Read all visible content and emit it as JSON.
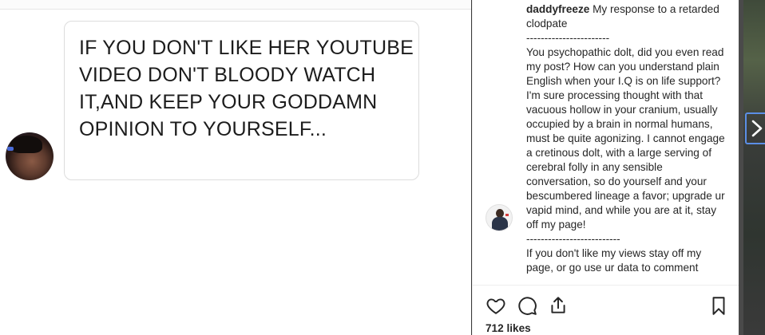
{
  "post_image": {
    "bubble_text": "IF YOU DON'T LIKE HER YOUTUBE VIDEO DON'T BLOODY WATCH IT,AND KEEP YOUR GODDAMN OPINION TO YOURSELF..."
  },
  "comment": {
    "username": "daddyfreeze",
    "body": " My response to a retarded clodpate\n-----------------------\nYou psychopathic dolt, did you even read my post? How can you understand plain English when your I.Q is on life support? I'm sure processing thought with that vacuous hollow in your cranium, usually occupied by a brain in normal humans, must be quite agonizing. I cannot engage a cretinous dolt, with a large serving of cerebral folly in any sensible conversation, so do yourself and your bescumbered lineage a favor; upgrade ur vapid mind, and while you are at it, stay off my page!\n--------------------------\nIf you don't like my views stay off my page, or go use ur data to comment"
  },
  "actions": {
    "icons": [
      "heart-icon",
      "comment-bubble-icon",
      "share-icon",
      "bookmark-icon"
    ],
    "likes_label": "712 likes"
  },
  "colors": {
    "text": "#262626",
    "border": "#efefef",
    "focus_outline": "#5b8ee6"
  }
}
